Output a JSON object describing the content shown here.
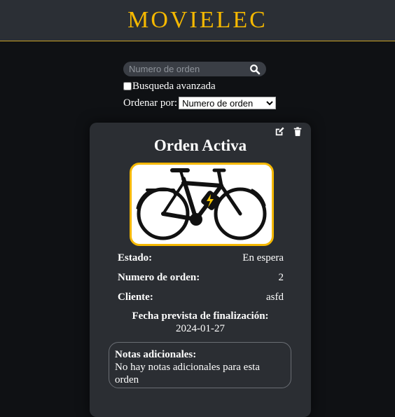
{
  "header": {
    "brand": "MOVIELEC"
  },
  "search": {
    "placeholder": "Numero de orden",
    "value": ""
  },
  "advanced": {
    "label": "Busqueda avanzada",
    "checked": false
  },
  "sort": {
    "label": "Ordenar por:",
    "selected": "Numero de orden"
  },
  "card": {
    "title": "Orden Activa",
    "status_label": "Estado:",
    "status_value": "En espera",
    "order_label": "Numero de orden:",
    "order_value": "2",
    "client_label": "Cliente:",
    "client_value": "asfd",
    "due_label": "Fecha prevista de finalización:",
    "due_value": "2024-01-27",
    "notes_label": "Notas adicionales:",
    "notes_value": "No hay notas adicionales para esta orden"
  },
  "icons": {
    "search": "search-icon",
    "edit": "edit-icon",
    "delete": "trash-icon",
    "bike": "electric-bike-image"
  },
  "colors": {
    "accent": "#f5b800",
    "header_bg": "#2b2f35",
    "page_bg": "#0f1114",
    "card_bg": "#2b2e33"
  }
}
